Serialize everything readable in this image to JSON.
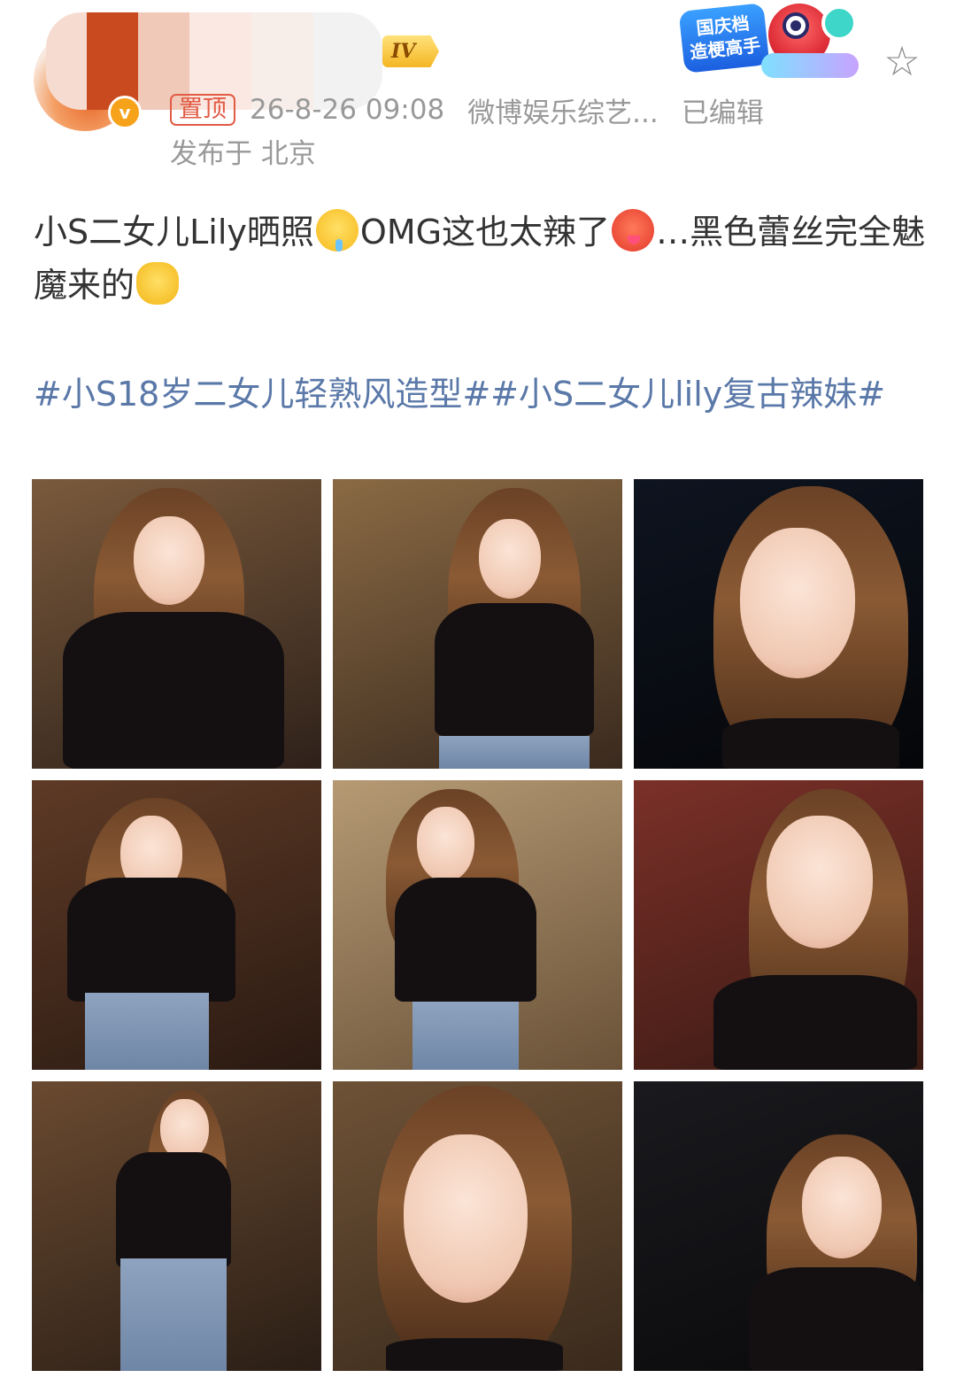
{
  "header": {
    "username": "",
    "level_badge": "IV",
    "verified_mark": "v",
    "event_badge": {
      "line1": "国庆档",
      "line2": "造梗高手"
    },
    "pin_label": "置顶",
    "timestamp": "26-8-26 09:08",
    "source": "微博娱乐综艺...",
    "edited_label": "已编辑",
    "location": "发布于 北京",
    "star_icon": "☆"
  },
  "post": {
    "text_part1": "小S二女儿Lily晒照",
    "text_part2": "OMG这也太辣了",
    "text_part3": "…黑色蕾丝完全魅魔来的",
    "emojis": [
      "drooling-face",
      "hot-face",
      "palms-up-together"
    ],
    "hashtags": "#小S18岁二女儿轻熟风造型##小S二女儿lily复古辣妹#"
  },
  "photos": [
    {
      "id": "photo-1",
      "bg": "#7a5a3c",
      "bg2": "#2e211a"
    },
    {
      "id": "photo-2",
      "bg": "#8a6a44",
      "bg2": "#3a2a1e"
    },
    {
      "id": "photo-3",
      "bg": "#0e1420",
      "bg2": "#050608"
    },
    {
      "id": "photo-4",
      "bg": "#5e3a26",
      "bg2": "#2a1a12"
    },
    {
      "id": "photo-5",
      "bg": "#b59a74",
      "bg2": "#6a5238"
    },
    {
      "id": "photo-6",
      "bg": "#7a3028",
      "bg2": "#3a1a14"
    },
    {
      "id": "photo-7",
      "bg": "#6a4a30",
      "bg2": "#2a1e16"
    },
    {
      "id": "photo-8",
      "bg": "#6e5236",
      "bg2": "#3a2a1c"
    },
    {
      "id": "photo-9",
      "bg": "#1a1a1e",
      "bg2": "#0a0a0c"
    }
  ],
  "colors": {
    "text": "#333333",
    "meta": "#999999",
    "hashtag": "#5a78a8",
    "pin": "#e25b45",
    "badge_gold": "#f4b623"
  }
}
